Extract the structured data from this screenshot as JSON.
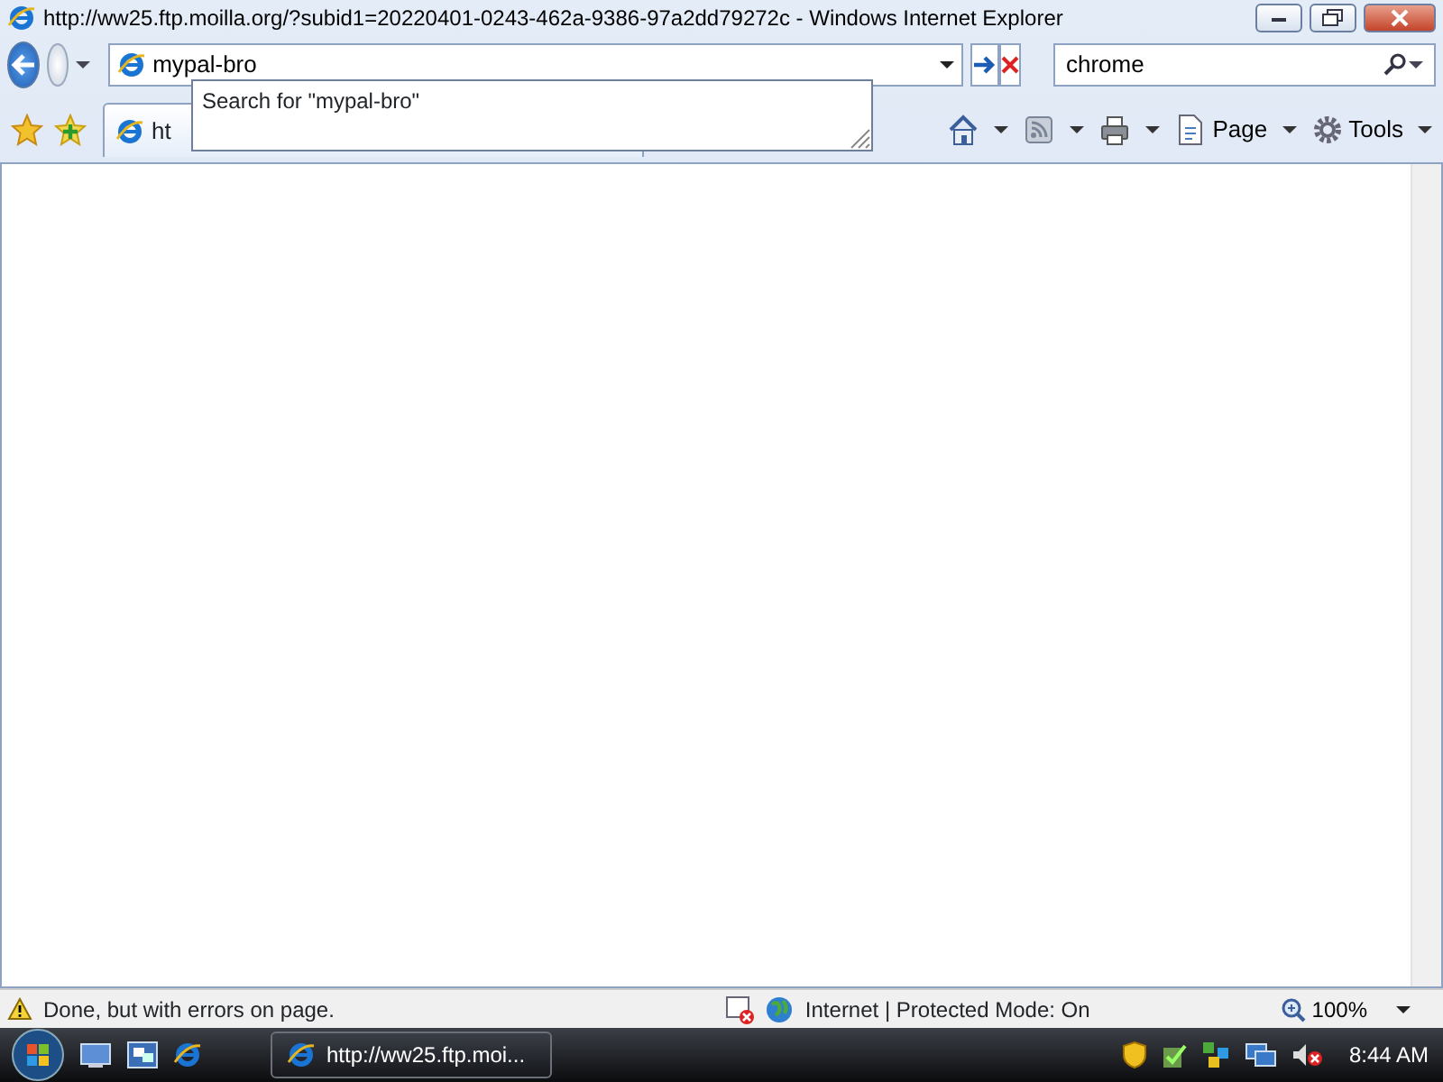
{
  "window": {
    "title": "http://ww25.ftp.moilla.org/?subid1=20220401-0243-462a-9386-97a2dd79272c - Windows Internet Explorer"
  },
  "address_bar": {
    "value": "mypal-bro"
  },
  "autocomplete": {
    "items": [
      "Search for \"mypal-bro\""
    ]
  },
  "search": {
    "value": "chrome"
  },
  "tab": {
    "label": "ht"
  },
  "toolbar": {
    "items": [
      {
        "kind": "home"
      },
      {
        "kind": "feeds"
      },
      {
        "kind": "print"
      },
      {
        "kind": "page",
        "label": "Page"
      },
      {
        "kind": "tools",
        "label": "Tools"
      }
    ]
  },
  "status_bar": {
    "message": "Done, but with errors on page.",
    "zone": "Internet | Protected Mode: On",
    "zoom": "100%"
  },
  "taskbar": {
    "window_button": "http://ww25.ftp.moi...",
    "clock": "8:44 AM"
  }
}
